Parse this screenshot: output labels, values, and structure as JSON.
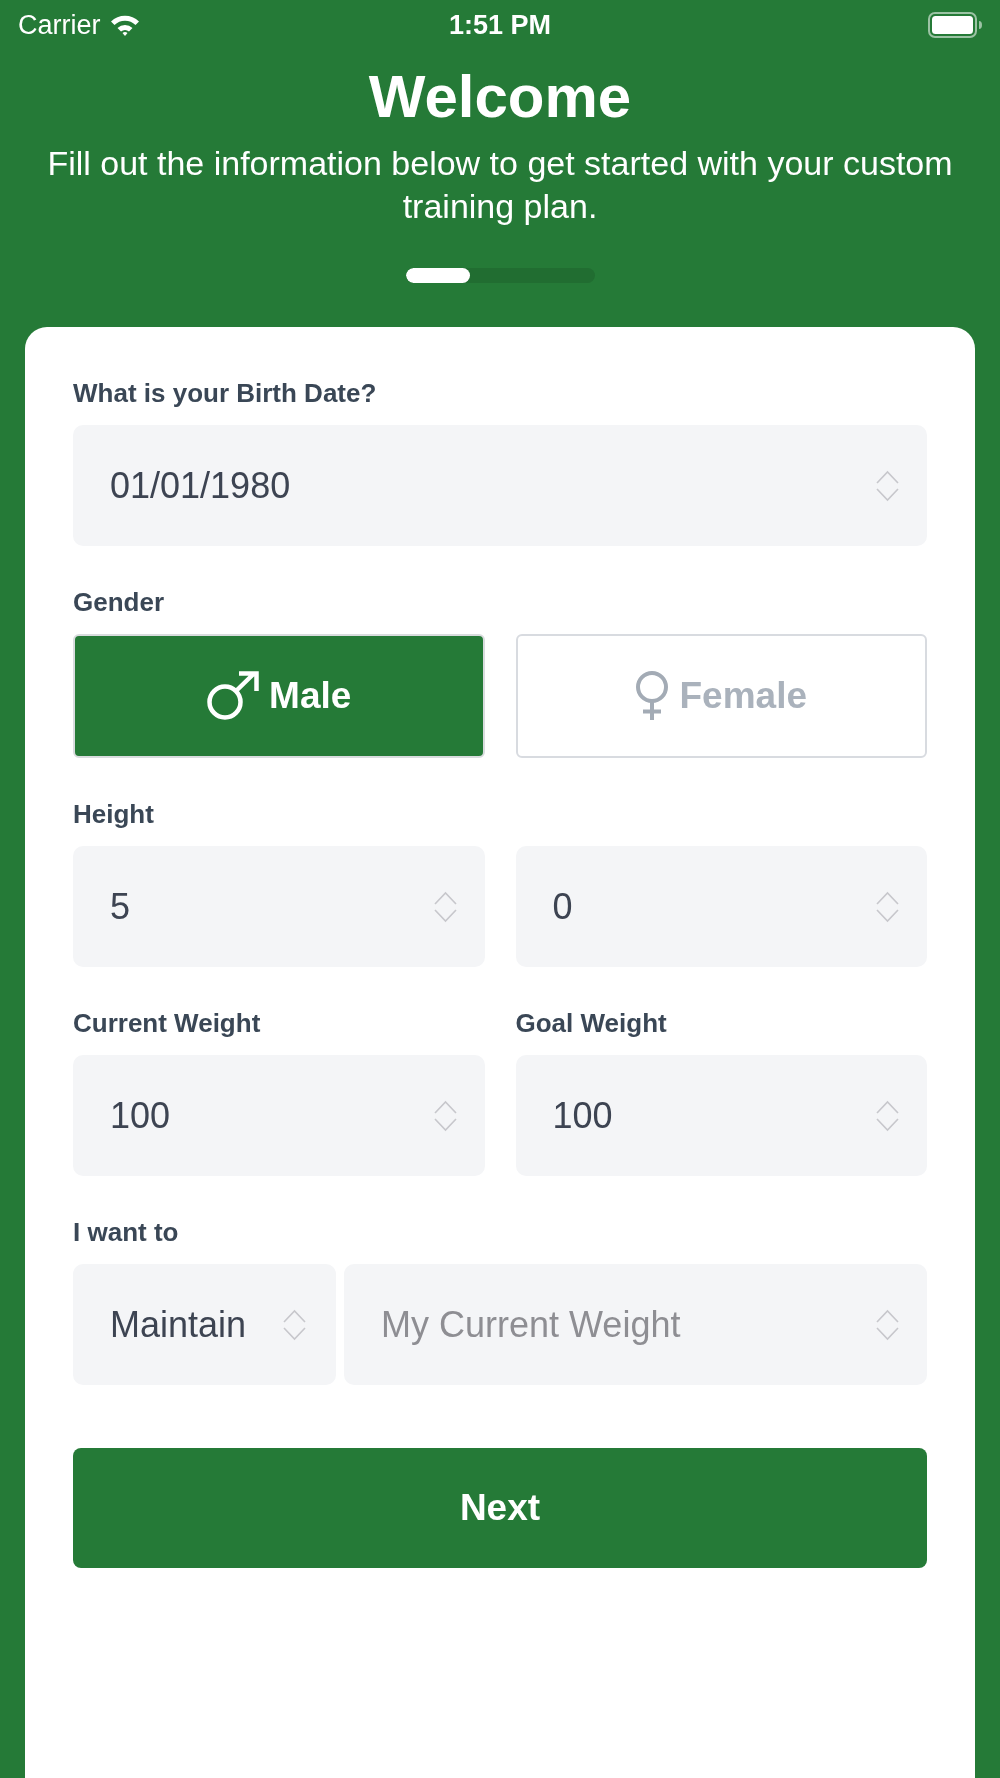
{
  "status_bar": {
    "carrier": "Carrier",
    "time": "1:51 PM"
  },
  "header": {
    "title": "Welcome",
    "subtitle": "Fill out the information below to get started with your custom training plan.",
    "progress": {
      "level": 0.34
    }
  },
  "form": {
    "birth_date": {
      "label": "What is your Birth Date?",
      "value": "01/01/1980"
    },
    "gender": {
      "label": "Gender",
      "options": [
        {
          "label": "Male",
          "kind": "male",
          "selected": true
        },
        {
          "label": "Female",
          "kind": "female",
          "selected": false
        }
      ]
    },
    "height": {
      "label": "Height",
      "fields": [
        {
          "value": "5"
        },
        {
          "value": "0"
        }
      ]
    },
    "weights": [
      {
        "label": "Current Weight",
        "value": "100"
      },
      {
        "label": "Goal Weight",
        "value": "100"
      }
    ],
    "goal": {
      "label": "I want to",
      "fields": [
        {
          "value": "Maintain"
        },
        {
          "placeholder": "My Current Weight"
        }
      ]
    }
  },
  "next_button": {
    "label": "Next"
  }
}
